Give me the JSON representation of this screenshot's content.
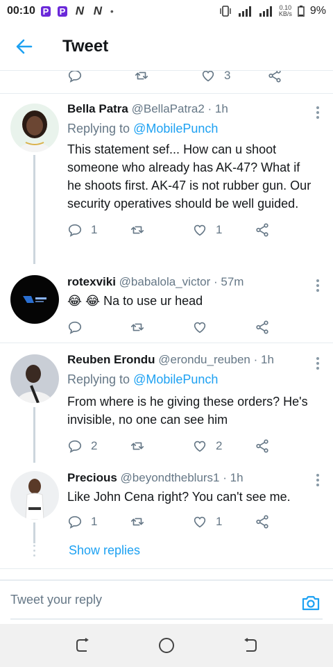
{
  "status_bar": {
    "time": "00:10",
    "app_icons": [
      "P",
      "P",
      "N",
      "N"
    ],
    "dot": "•",
    "speed_value": "0.10",
    "speed_unit": "KB/s",
    "battery": "9%"
  },
  "header": {
    "title": "Tweet"
  },
  "top_partial_actions": {
    "like_count": "3"
  },
  "tweets": [
    {
      "name": "Bella Patra",
      "handle": "@BellaPatra2",
      "time": "· 1h",
      "replying_prefix": "Replying to ",
      "replying_handle": "@MobilePunch",
      "text": "This statement sef... How can u shoot someone who already has AK-47? What if he shoots first. AK-47 is not rubber gun. Our security operatives should be well guided.",
      "reply_count": "1",
      "retweet_count": "",
      "like_count": "1"
    },
    {
      "name": "rotexviki",
      "handle": "@babalola_victor",
      "time": "· 57m",
      "text": "😂 😂 Na to use ur head",
      "reply_count": "",
      "retweet_count": "",
      "like_count": ""
    },
    {
      "name": "Reuben Erondu",
      "handle": "@erondu_reuben",
      "time": "· 1h",
      "replying_prefix": "Replying to ",
      "replying_handle": "@MobilePunch",
      "text": "From where is he giving these orders? He's invisible, no one can see him",
      "reply_count": "2",
      "retweet_count": "",
      "like_count": "2"
    },
    {
      "name": "Precious",
      "handle": "@beyondtheblurs1",
      "time": "· 1h",
      "text": "Like John Cena right? You can't see me.",
      "reply_count": "1",
      "retweet_count": "",
      "like_count": "1"
    }
  ],
  "show_replies": "Show replies",
  "reply_box": {
    "placeholder": "Tweet your reply"
  },
  "colors": {
    "accent": "#1da1f2",
    "secondary_text": "#657786",
    "divider": "#e6ecf0"
  }
}
